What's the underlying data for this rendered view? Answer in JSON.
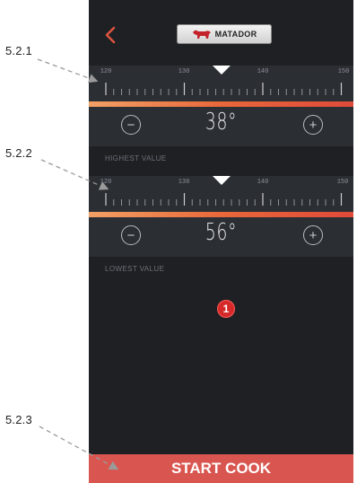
{
  "callouts": {
    "c1": "5.2.1",
    "c2": "5.2.2",
    "c3": "5.2.3"
  },
  "header": {
    "back_icon": "chevron-left-icon",
    "logo_text": "MATADOR",
    "logo_icon": "bull-icon"
  },
  "highest": {
    "scale_labels": [
      "120",
      "130",
      "140",
      "150"
    ],
    "value": "38°",
    "minus": "−",
    "plus": "+",
    "caption": "HIGHEST VALUE"
  },
  "lowest": {
    "scale_labels": [
      "120",
      "130",
      "140",
      "150"
    ],
    "value": "56°",
    "minus": "−",
    "plus": "+",
    "caption": "LOWEST VALUE"
  },
  "badge": "1",
  "start_button": "START COOK",
  "colors": {
    "background": "#1f2024",
    "panel": "#2b2e33",
    "accent": "#d95650",
    "bar_gradient": [
      "#f2a065",
      "#e04a3a"
    ]
  }
}
